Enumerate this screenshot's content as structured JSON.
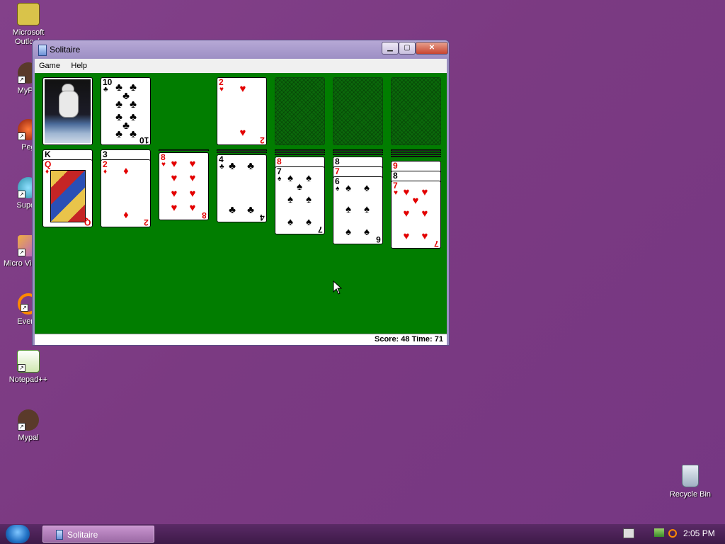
{
  "desktop": {
    "icons": [
      {
        "label": "Microsoft Outlook",
        "icon": "outlook-icon"
      },
      {
        "label": "MyPal",
        "icon": "mypal-shortcut-icon"
      },
      {
        "label": "Peg",
        "icon": "peg-icon"
      },
      {
        "label": "Superr",
        "icon": "super-icon"
      },
      {
        "label": "Micro Visual S",
        "icon": "visual-studio-icon"
      },
      {
        "label": "Everyt",
        "icon": "everything-icon"
      },
      {
        "label": "Notepad++",
        "icon": "notepadpp-icon"
      },
      {
        "label": "Mypal",
        "icon": "mypal-icon"
      },
      {
        "label": "Recycle Bin",
        "icon": "recycle-bin-icon"
      }
    ]
  },
  "window": {
    "title": "Solitaire",
    "menu": [
      "Game",
      "Help"
    ],
    "status": "Score: 48 Time: 71"
  },
  "game": {
    "foundations": [
      {
        "rank": "2",
        "suit": "♥",
        "color": "red"
      },
      {
        "empty": true
      },
      {
        "empty": true
      },
      {
        "empty": true
      }
    ],
    "waste_top": {
      "rank": "10",
      "suit": "♣",
      "color": "black"
    },
    "tableau": [
      {
        "hidden_labels": [
          "K"
        ],
        "top": {
          "rank": "Q",
          "suit": "♦",
          "color": "red"
        }
      },
      {
        "hidden_labels": [
          "3"
        ],
        "top": {
          "rank": "2",
          "suit": "♦",
          "color": "red"
        }
      },
      {
        "hidden_labels": [],
        "top": {
          "rank": "8",
          "suit": "♥",
          "color": "red"
        }
      },
      {
        "hidden_labels": [],
        "top": {
          "rank": "4",
          "suit": "♣",
          "color": "black"
        }
      },
      {
        "hidden_labels": [
          "8"
        ],
        "top": {
          "rank": "7",
          "suit": "♠",
          "color": "black"
        }
      },
      {
        "hidden_labels": [
          "8",
          "7"
        ],
        "top": {
          "rank": "6",
          "suit": "♠",
          "color": "black"
        }
      },
      {
        "hidden_labels": [
          "9",
          "8"
        ],
        "top": {
          "rank": "7",
          "suit": "♥",
          "color": "red"
        }
      }
    ]
  },
  "taskbar": {
    "task_label": "Solitaire",
    "clock": "2:05 PM"
  },
  "colors": {
    "felt": "#017d00",
    "desktop": "#7b3a82",
    "red_suit": "#e30000"
  }
}
